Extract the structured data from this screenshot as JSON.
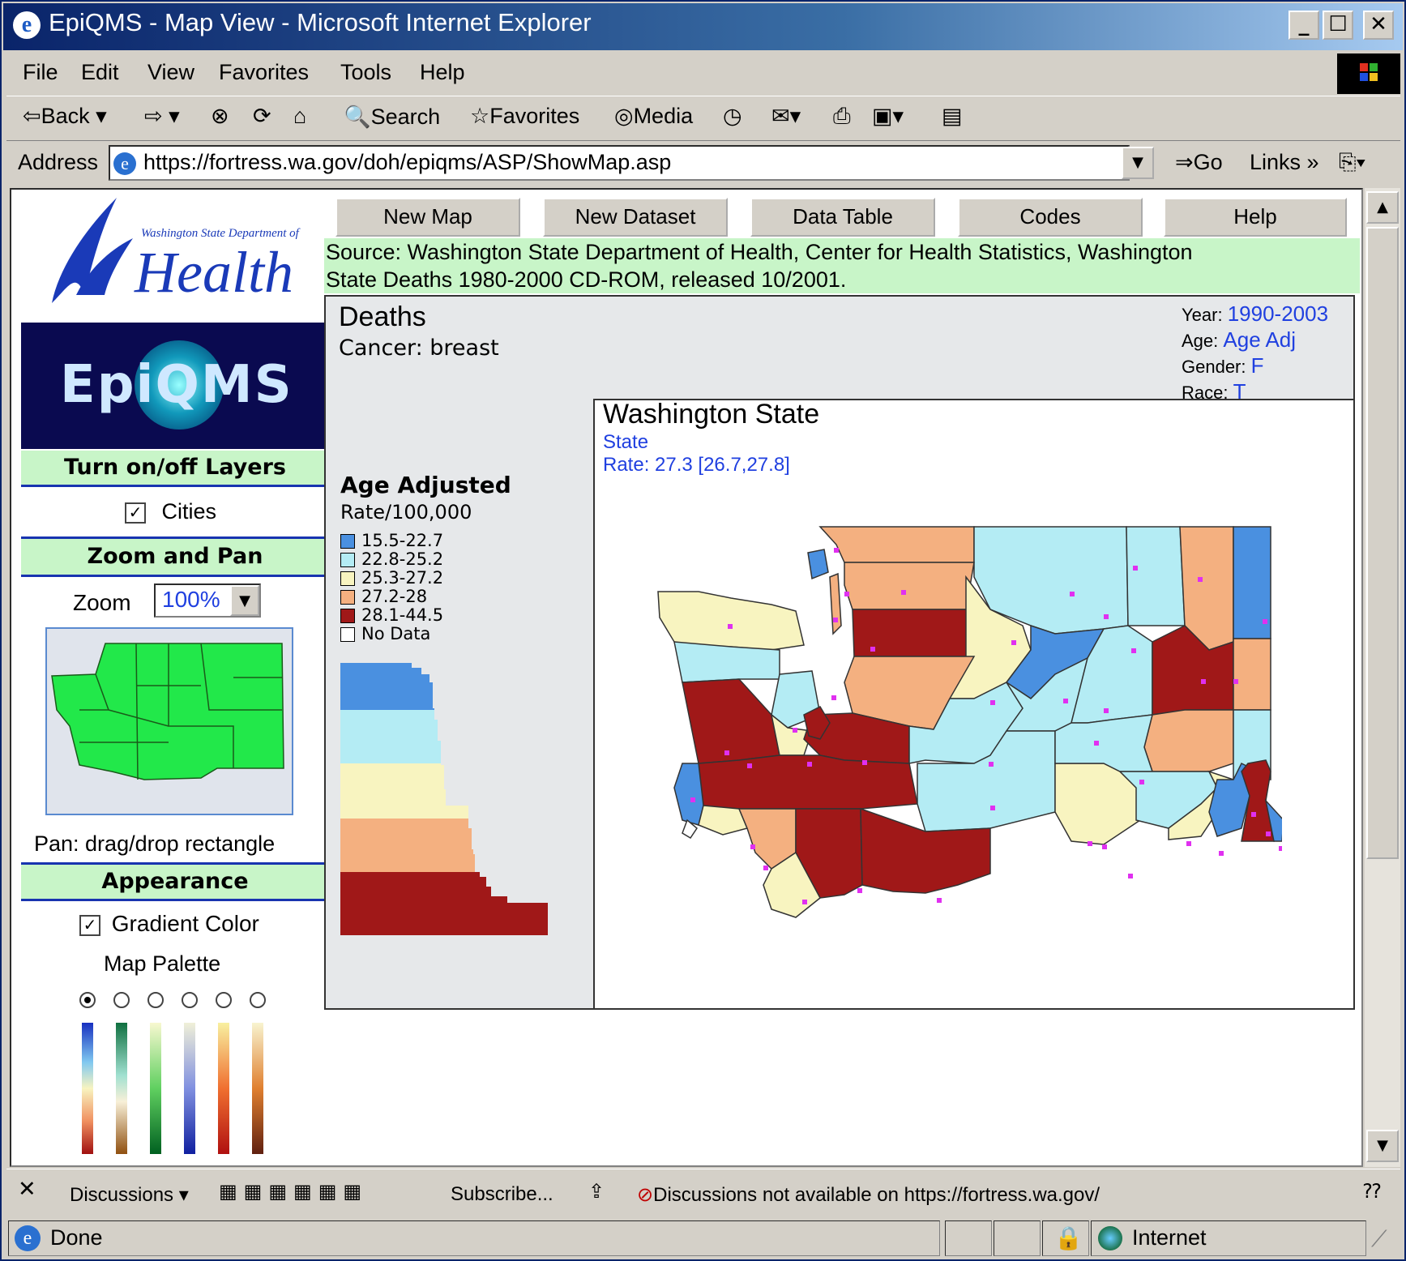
{
  "window": {
    "title": "EpiQMS - Map View - Microsoft Internet Explorer"
  },
  "menu": [
    "File",
    "Edit",
    "View",
    "Favorites",
    "Tools",
    "Help"
  ],
  "toolbar": {
    "back": "Back",
    "search": "Search",
    "favorites": "Favorites",
    "media": "Media"
  },
  "address": {
    "label": "Address",
    "url": "https://fortress.wa.gov/doh/epiqms/ASP/ShowMap.asp",
    "go": "Go",
    "links": "Links"
  },
  "logo": {
    "dept": "Washington State Department of",
    "health": "Health",
    "epiqms": "EpiQMS"
  },
  "sidebar": {
    "layers_title": "Turn on/off Layers",
    "cities": "Cities",
    "zoom_title": "Zoom and Pan",
    "zoom_label": "Zoom",
    "zoom_value": "100%",
    "pan": "Pan: drag/drop rectangle",
    "appearance_title": "Appearance",
    "gradient": "Gradient Color",
    "palette": "Map Palette"
  },
  "nav": [
    "New Map",
    "New Dataset",
    "Data Table",
    "Codes",
    "Help"
  ],
  "source_line1": "Source: Washington State Department of Health, Center for Health Statistics, Washington",
  "source_line2": "State Deaths 1980-2000 CD-ROM, released 10/2001.",
  "panel": {
    "title": "Deaths",
    "subtitle": "Cancer:  breast",
    "year_label": "Year:",
    "year": "1990-2003",
    "age_label": "Age:",
    "age": "Age Adj",
    "gender_label": "Gender:",
    "gender": "F",
    "race_label": "Race:",
    "race": "T"
  },
  "legend": {
    "title": "Age Adjusted",
    "unit": "Rate/100,000",
    "items": [
      {
        "label": "15.5-22.7",
        "color": "#4a90e0"
      },
      {
        "label": "22.8-25.2",
        "color": "#b4ecf4"
      },
      {
        "label": "25.3-27.2",
        "color": "#f8f4c0"
      },
      {
        "label": "27.2-28",
        "color": "#f4b080"
      },
      {
        "label": "28.1-44.5",
        "color": "#a01818"
      },
      {
        "label": "No Data",
        "color": "#ffffff"
      }
    ]
  },
  "map": {
    "title": "Washington State",
    "level": "State",
    "rate": "Rate:  27.3 [26.7,27.8]"
  },
  "discussions": {
    "label": "Discussions",
    "subscribe": "Subscribe...",
    "message": "Discussions not available on https://fortress.wa.gov/"
  },
  "status": {
    "done": "Done",
    "zone": "Internet"
  }
}
